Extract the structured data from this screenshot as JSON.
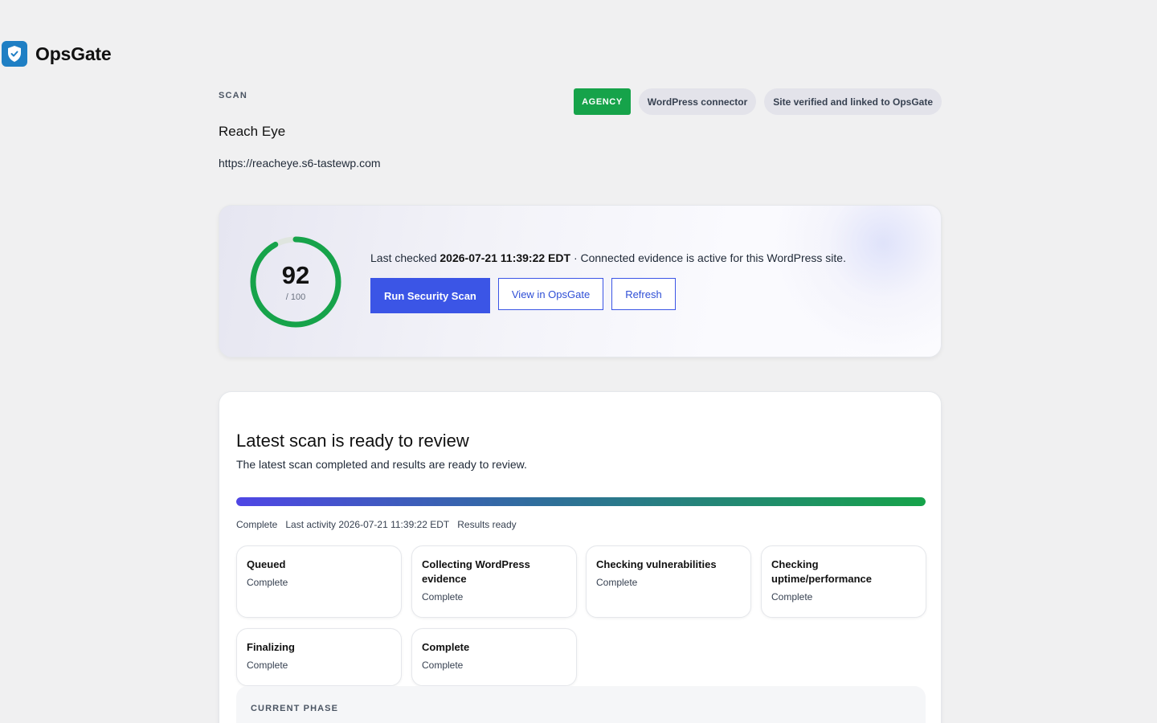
{
  "brand": {
    "name": "OpsGate",
    "icon": "shield-check-icon",
    "color": "#1f7fc4"
  },
  "header": {
    "eyebrow": "SCAN",
    "site_name": "Reach Eye",
    "site_url": "https://reacheye.s6-tastewp.com",
    "badges": {
      "agency": "AGENCY",
      "connector": "WordPress connector",
      "verified": "Site verified and linked to OpsGate"
    }
  },
  "score": {
    "value": "92",
    "max_label": "/ 100",
    "fraction": 0.92,
    "color": "#16a34a"
  },
  "status": {
    "prefix": "Last checked ",
    "timestamp": "2026-07-21 11:39:22 EDT",
    "suffix": " · Connected evidence is active for this WordPress site."
  },
  "actions": {
    "run_scan": "Run Security Scan",
    "view": "View in OpsGate",
    "refresh": "Refresh"
  },
  "scan": {
    "title": "Latest scan is ready to review",
    "subtitle": "The latest scan completed and results are ready to review.",
    "progress_percent": 100,
    "meta": {
      "state": "Complete",
      "last_activity": "Last activity 2026-07-21 11:39:22 EDT",
      "results": "Results ready"
    },
    "steps": [
      {
        "title": "Queued",
        "status": "Complete"
      },
      {
        "title": "Collecting WordPress evidence",
        "status": "Complete"
      },
      {
        "title": "Checking vulnerabilities",
        "status": "Complete"
      },
      {
        "title": "Checking uptime/performance",
        "status": "Complete"
      },
      {
        "title": "Finalizing",
        "status": "Complete"
      },
      {
        "title": "Complete",
        "status": "Complete"
      }
    ],
    "current_phase_label": "CURRENT PHASE"
  }
}
